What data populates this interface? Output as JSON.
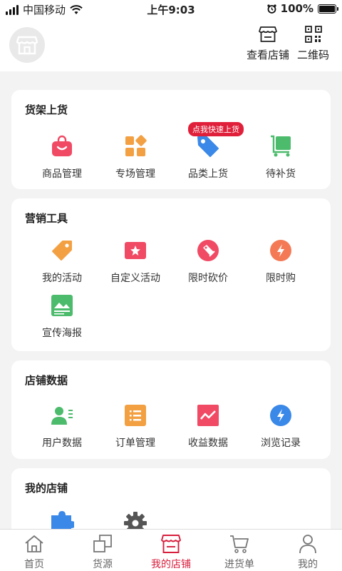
{
  "status_bar": {
    "carrier": "中国移动",
    "time": "上午9:03",
    "battery": "100%"
  },
  "header": {
    "shop_label": "查看店铺",
    "qr_label": "二维码"
  },
  "shelf": {
    "title": "货架上货",
    "badge": "点我快速上货",
    "items": [
      {
        "label": "商品管理",
        "icon": "shopping-bag-icon",
        "color": "#f04a64"
      },
      {
        "label": "专场管理",
        "icon": "grid-squares-icon",
        "color": "#f3a043"
      },
      {
        "label": "品类上货",
        "icon": "price-tag-icon",
        "color": "#3a88e8"
      },
      {
        "label": "待补货",
        "icon": "cart-icon",
        "color": "#4cbb6c"
      }
    ]
  },
  "marketing": {
    "title": "营销工具",
    "items": [
      {
        "label": "我的活动",
        "icon": "tag-icon",
        "color": "#f3a043"
      },
      {
        "label": "自定义活动",
        "icon": "star-ticket-icon",
        "color": "#f04a64"
      },
      {
        "label": "限时砍价",
        "icon": "discount-icon",
        "color": "#f04a64"
      },
      {
        "label": "限时购",
        "icon": "flash-icon",
        "color": "#f47a55"
      },
      {
        "label": "宣传海报",
        "icon": "poster-icon",
        "color": "#4cbb6c"
      }
    ]
  },
  "shop_data": {
    "title": "店铺数据",
    "items": [
      {
        "label": "用户数据",
        "icon": "user-data-icon",
        "color": "#4cbb6c"
      },
      {
        "label": "订单管理",
        "icon": "order-list-icon",
        "color": "#f3a043"
      },
      {
        "label": "收益数据",
        "icon": "trend-chart-icon",
        "color": "#f04a64"
      },
      {
        "label": "浏览记录",
        "icon": "flash-circle-icon",
        "color": "#3a88e8"
      }
    ]
  },
  "my_shop": {
    "title": "我的店铺"
  },
  "tabbar": {
    "tabs": [
      {
        "label": "首页",
        "icon": "home-icon"
      },
      {
        "label": "货源",
        "icon": "source-icon"
      },
      {
        "label": "我的店铺",
        "icon": "store-icon",
        "active": true
      },
      {
        "label": "进货单",
        "icon": "cart-icon"
      },
      {
        "label": "我的",
        "icon": "profile-icon"
      }
    ]
  }
}
